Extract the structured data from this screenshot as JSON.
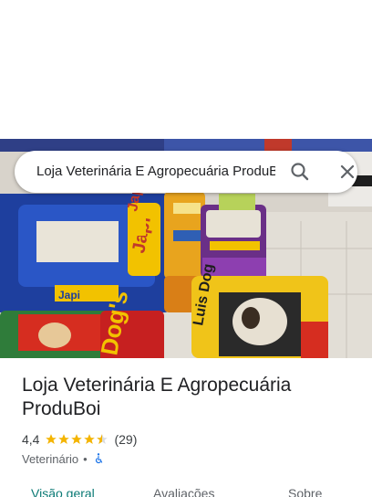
{
  "search": {
    "query": "Loja Veterinária E Agropecuária ProduBoi",
    "search_icon": "search-icon",
    "close_icon": "close-icon"
  },
  "place": {
    "name": "Loja Veterinária E Agropecuária ProduBoi",
    "rating": "4,4",
    "rating_value": 4.4,
    "reviews": "(29)",
    "category": "Veterinário",
    "separator": "•",
    "accessibility_icon": "wheelchair-accessible-icon"
  },
  "tabs": [
    {
      "label": "Visão geral",
      "active": true
    },
    {
      "label": "Avaliações",
      "active": false
    },
    {
      "label": "Sobre",
      "active": false
    }
  ],
  "colors": {
    "star": "#f4b400",
    "active_tab": "#0b7a75",
    "accessibility": "#1a73e8"
  },
  "photo": {
    "bag_labels": [
      "Japi",
      "Japi",
      "Japi",
      "Dog's",
      "Luis Dog"
    ]
  }
}
